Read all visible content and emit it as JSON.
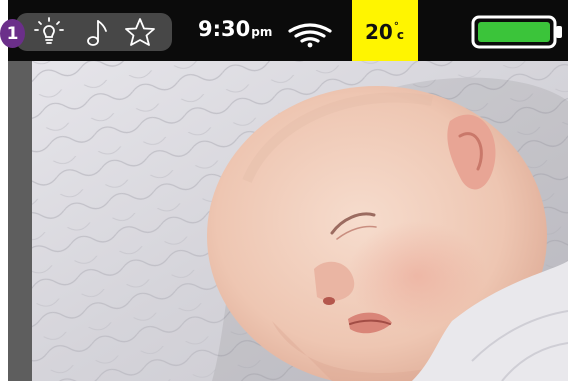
{
  "status_bar": {
    "badge": "1",
    "quick_icons": [
      "nightlight-bulb-icon",
      "lullaby-music-note-icon",
      "favorite-star-icon"
    ],
    "time": {
      "value": "9:30",
      "suffix": "pm"
    },
    "wifi": "wifi-signal-icon",
    "temperature": {
      "value": "20",
      "degree": "°",
      "unit": "c"
    },
    "battery": {
      "icon": "battery-icon",
      "level": 1.0
    }
  },
  "camera_view": {
    "subject": "sleeping-baby-image"
  },
  "colors": {
    "status_bar_bg": "#0b0b0b",
    "icon_pill_bg": "#474747",
    "badge_bg": "#6b2f8a",
    "temperature_highlight": "#fff500",
    "battery_fill": "#3bc43a",
    "bezel": "#5e5e5e"
  }
}
